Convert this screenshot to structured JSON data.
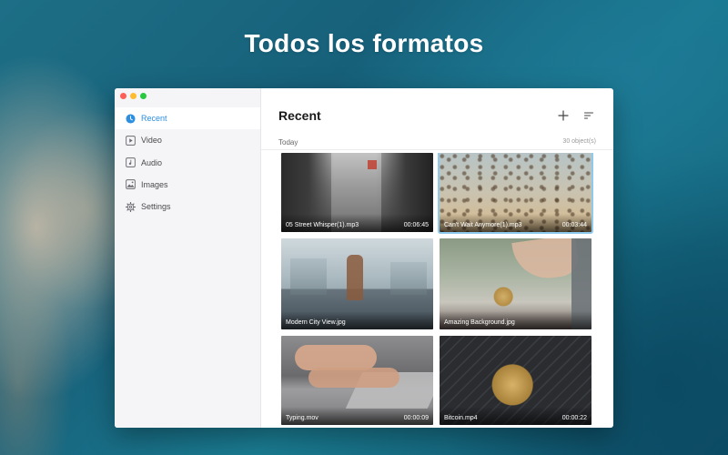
{
  "headline": "Todos los formatos",
  "window": {
    "controls": [
      "close",
      "minimize",
      "zoom"
    ]
  },
  "sidebar": {
    "items": [
      {
        "label": "Recent",
        "icon": "clock-icon",
        "active": true
      },
      {
        "label": "Video",
        "icon": "video-icon",
        "active": false
      },
      {
        "label": "Audio",
        "icon": "music-note-icon",
        "active": false
      },
      {
        "label": "Images",
        "icon": "image-icon",
        "active": false
      },
      {
        "label": "Settings",
        "icon": "gear-icon",
        "active": false
      }
    ]
  },
  "main": {
    "title": "Recent",
    "toolbar": {
      "add_icon": "plus-icon",
      "sort_icon": "sort-icon"
    },
    "section": "Today",
    "count": "30 object(s)",
    "items": [
      {
        "name": "05 Street Whisper(1).mp3",
        "duration": "00:06:45",
        "selected": false
      },
      {
        "name": "Can't Wait Anymore(1).mp3",
        "duration": "00:03:44",
        "selected": true
      },
      {
        "name": "Modern City View.jpg",
        "duration": "",
        "selected": false
      },
      {
        "name": "Amazing Background.jpg",
        "duration": "",
        "selected": false
      },
      {
        "name": "Typing.mov",
        "duration": "00:00:09",
        "selected": false
      },
      {
        "name": "Bitcoin.mp4",
        "duration": "00:00:22",
        "selected": false
      }
    ]
  },
  "colors": {
    "accent": "#2c8fe0",
    "selection_outline": "#8ec9ee"
  }
}
